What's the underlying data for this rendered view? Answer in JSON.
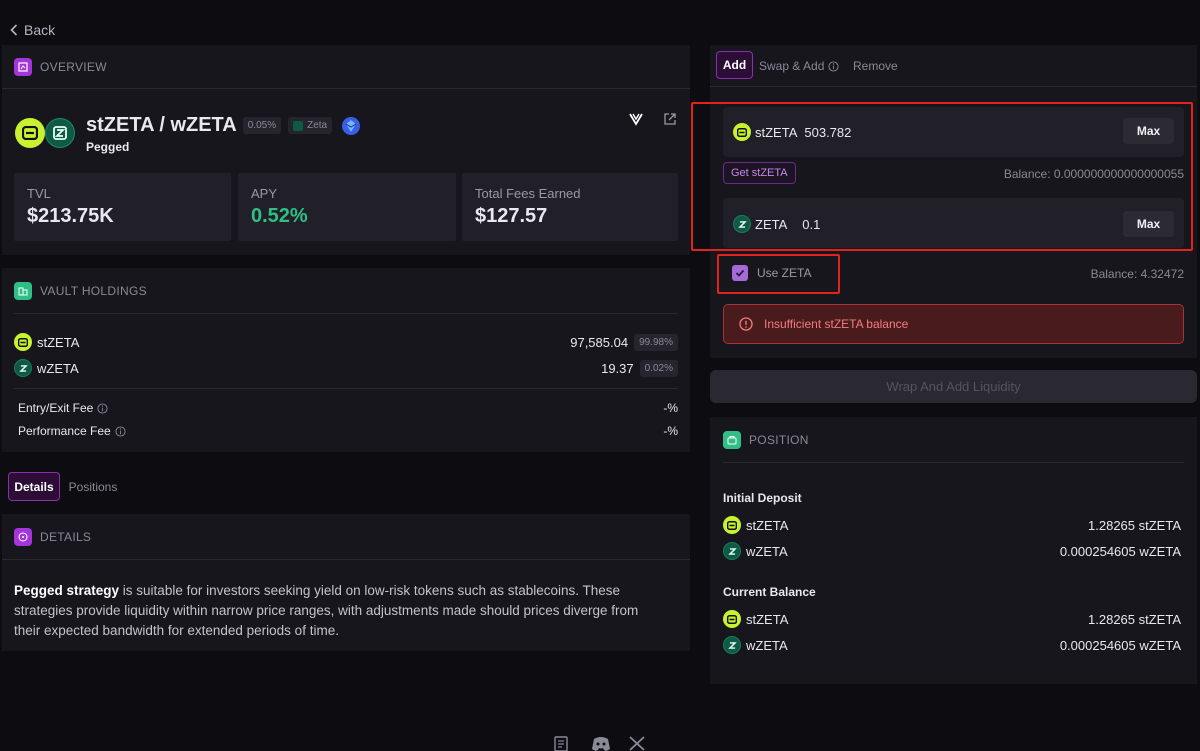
{
  "nav": {
    "back_label": "Back"
  },
  "overview": {
    "section_title": "OVERVIEW",
    "pair_name": "stZETA / wZETA",
    "fee_badge": "0.05%",
    "chain_badge": "Zeta",
    "strategy": "Pegged",
    "stats": [
      {
        "label": "TVL",
        "value": "$213.75K"
      },
      {
        "label": "APY",
        "value": "0.52%"
      },
      {
        "label": "Total Fees Earned",
        "value": "$127.57"
      }
    ]
  },
  "vault": {
    "section_title": "VAULT HOLDINGS",
    "holdings": [
      {
        "token": "stZETA",
        "amount": "97,585.04",
        "pct": "99.98%"
      },
      {
        "token": "wZETA",
        "amount": "19.37",
        "pct": "0.02%"
      }
    ],
    "fees": [
      {
        "label": "Entry/Exit Fee",
        "value": "-%"
      },
      {
        "label": "Performance Fee",
        "value": "-%"
      }
    ]
  },
  "tabs": {
    "details": "Details",
    "positions": "Positions"
  },
  "details": {
    "section_title": "DETAILS",
    "bold_lead": "Pegged strategy",
    "body_line1": " is suitable for investors seeking yield on low-risk tokens such as stablecoins. These",
    "body_line2": "strategies provide liquidity within narrow price ranges, with adjustments made should prices diverge from",
    "body_line3": "their expected bandwidth for extended periods of time."
  },
  "action_tabs": {
    "add": "Add",
    "swap_add": "Swap & Add",
    "remove": "Remove"
  },
  "deposit": {
    "token1": {
      "symbol": "stZETA",
      "amount": "503.782",
      "max_label": "Max"
    },
    "get_token_label": "Get stZETA",
    "balance1": "Balance: 0.000000000000000055",
    "token2": {
      "symbol": "ZETA",
      "amount": "0.1",
      "max_label": "Max"
    },
    "use_zeta_label": "Use ZETA",
    "balance2": "Balance: 4.32472",
    "error": "Insufficient stZETA balance",
    "submit_label": "Wrap And Add Liquidity"
  },
  "position": {
    "section_title": "POSITION",
    "initial_deposit_title": "Initial Deposit",
    "initial": [
      {
        "token": "stZETA",
        "value": "1.28265 stZETA"
      },
      {
        "token": "wZETA",
        "value": "0.000254605 wZETA"
      }
    ],
    "current_balance_title": "Current Balance",
    "current": [
      {
        "token": "stZETA",
        "value": "1.28265 stZETA"
      },
      {
        "token": "wZETA",
        "value": "0.000254605 wZETA"
      }
    ]
  },
  "colors": {
    "accent_purple": "#a435d8",
    "apy_green": "#2fbf86",
    "error_red": "#e0241d",
    "st_token": "#c8f230",
    "w_token": "#0f5a45"
  }
}
